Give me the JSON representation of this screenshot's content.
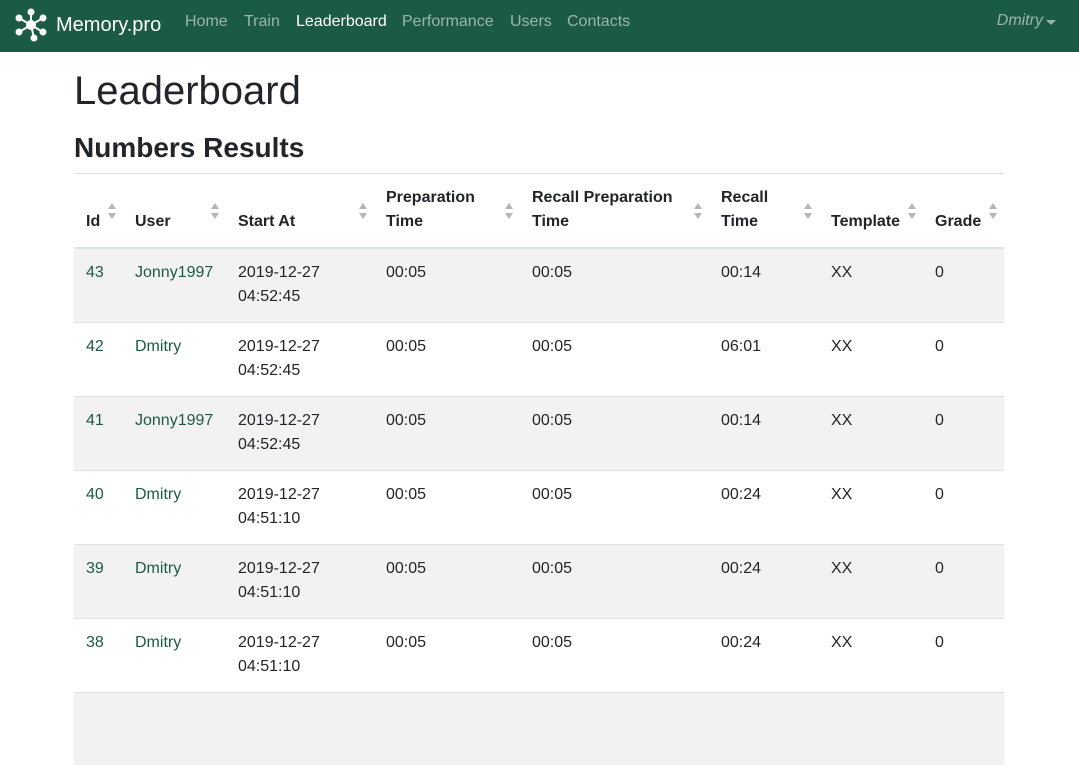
{
  "navbar": {
    "brand": "Memory.pro",
    "links": [
      "Home",
      "Train",
      "Leaderboard",
      "Performance",
      "Users",
      "Contacts"
    ],
    "active": "Leaderboard",
    "user": "Dmitry",
    "background": "#1b5b43"
  },
  "page": {
    "title": "Leaderboard",
    "section": "Numbers Results"
  },
  "table": {
    "headers": {
      "id": "Id",
      "user": "User",
      "start_at": "Start At",
      "prep_time": "Preparation Time",
      "recall_prep_time": "Recall Preparation Time",
      "recall_time": "Recall Time",
      "template": "Template",
      "grade": "Grade"
    },
    "rows": [
      {
        "id": "43",
        "user": "Jonny1997",
        "start_date": "2019-12-27",
        "start_time": "04:52:45",
        "prep": "00:05",
        "recall_prep": "00:05",
        "recall": "00:14",
        "template": "XX",
        "grade": "0"
      },
      {
        "id": "42",
        "user": "Dmitry",
        "start_date": "2019-12-27",
        "start_time": "04:52:45",
        "prep": "00:05",
        "recall_prep": "00:05",
        "recall": "06:01",
        "template": "XX",
        "grade": "0"
      },
      {
        "id": "41",
        "user": "Jonny1997",
        "start_date": "2019-12-27",
        "start_time": "04:52:45",
        "prep": "00:05",
        "recall_prep": "00:05",
        "recall": "00:14",
        "template": "XX",
        "grade": "0"
      },
      {
        "id": "40",
        "user": "Dmitry",
        "start_date": "2019-12-27",
        "start_time": "04:51:10",
        "prep": "00:05",
        "recall_prep": "00:05",
        "recall": "00:24",
        "template": "XX",
        "grade": "0"
      },
      {
        "id": "39",
        "user": "Dmitry",
        "start_date": "2019-12-27",
        "start_time": "04:51:10",
        "prep": "00:05",
        "recall_prep": "00:05",
        "recall": "00:24",
        "template": "XX",
        "grade": "0"
      },
      {
        "id": "38",
        "user": "Dmitry",
        "start_date": "2019-12-27",
        "start_time": "04:51:10",
        "prep": "00:05",
        "recall_prep": "00:05",
        "recall": "00:24",
        "template": "XX",
        "grade": "0"
      }
    ]
  }
}
